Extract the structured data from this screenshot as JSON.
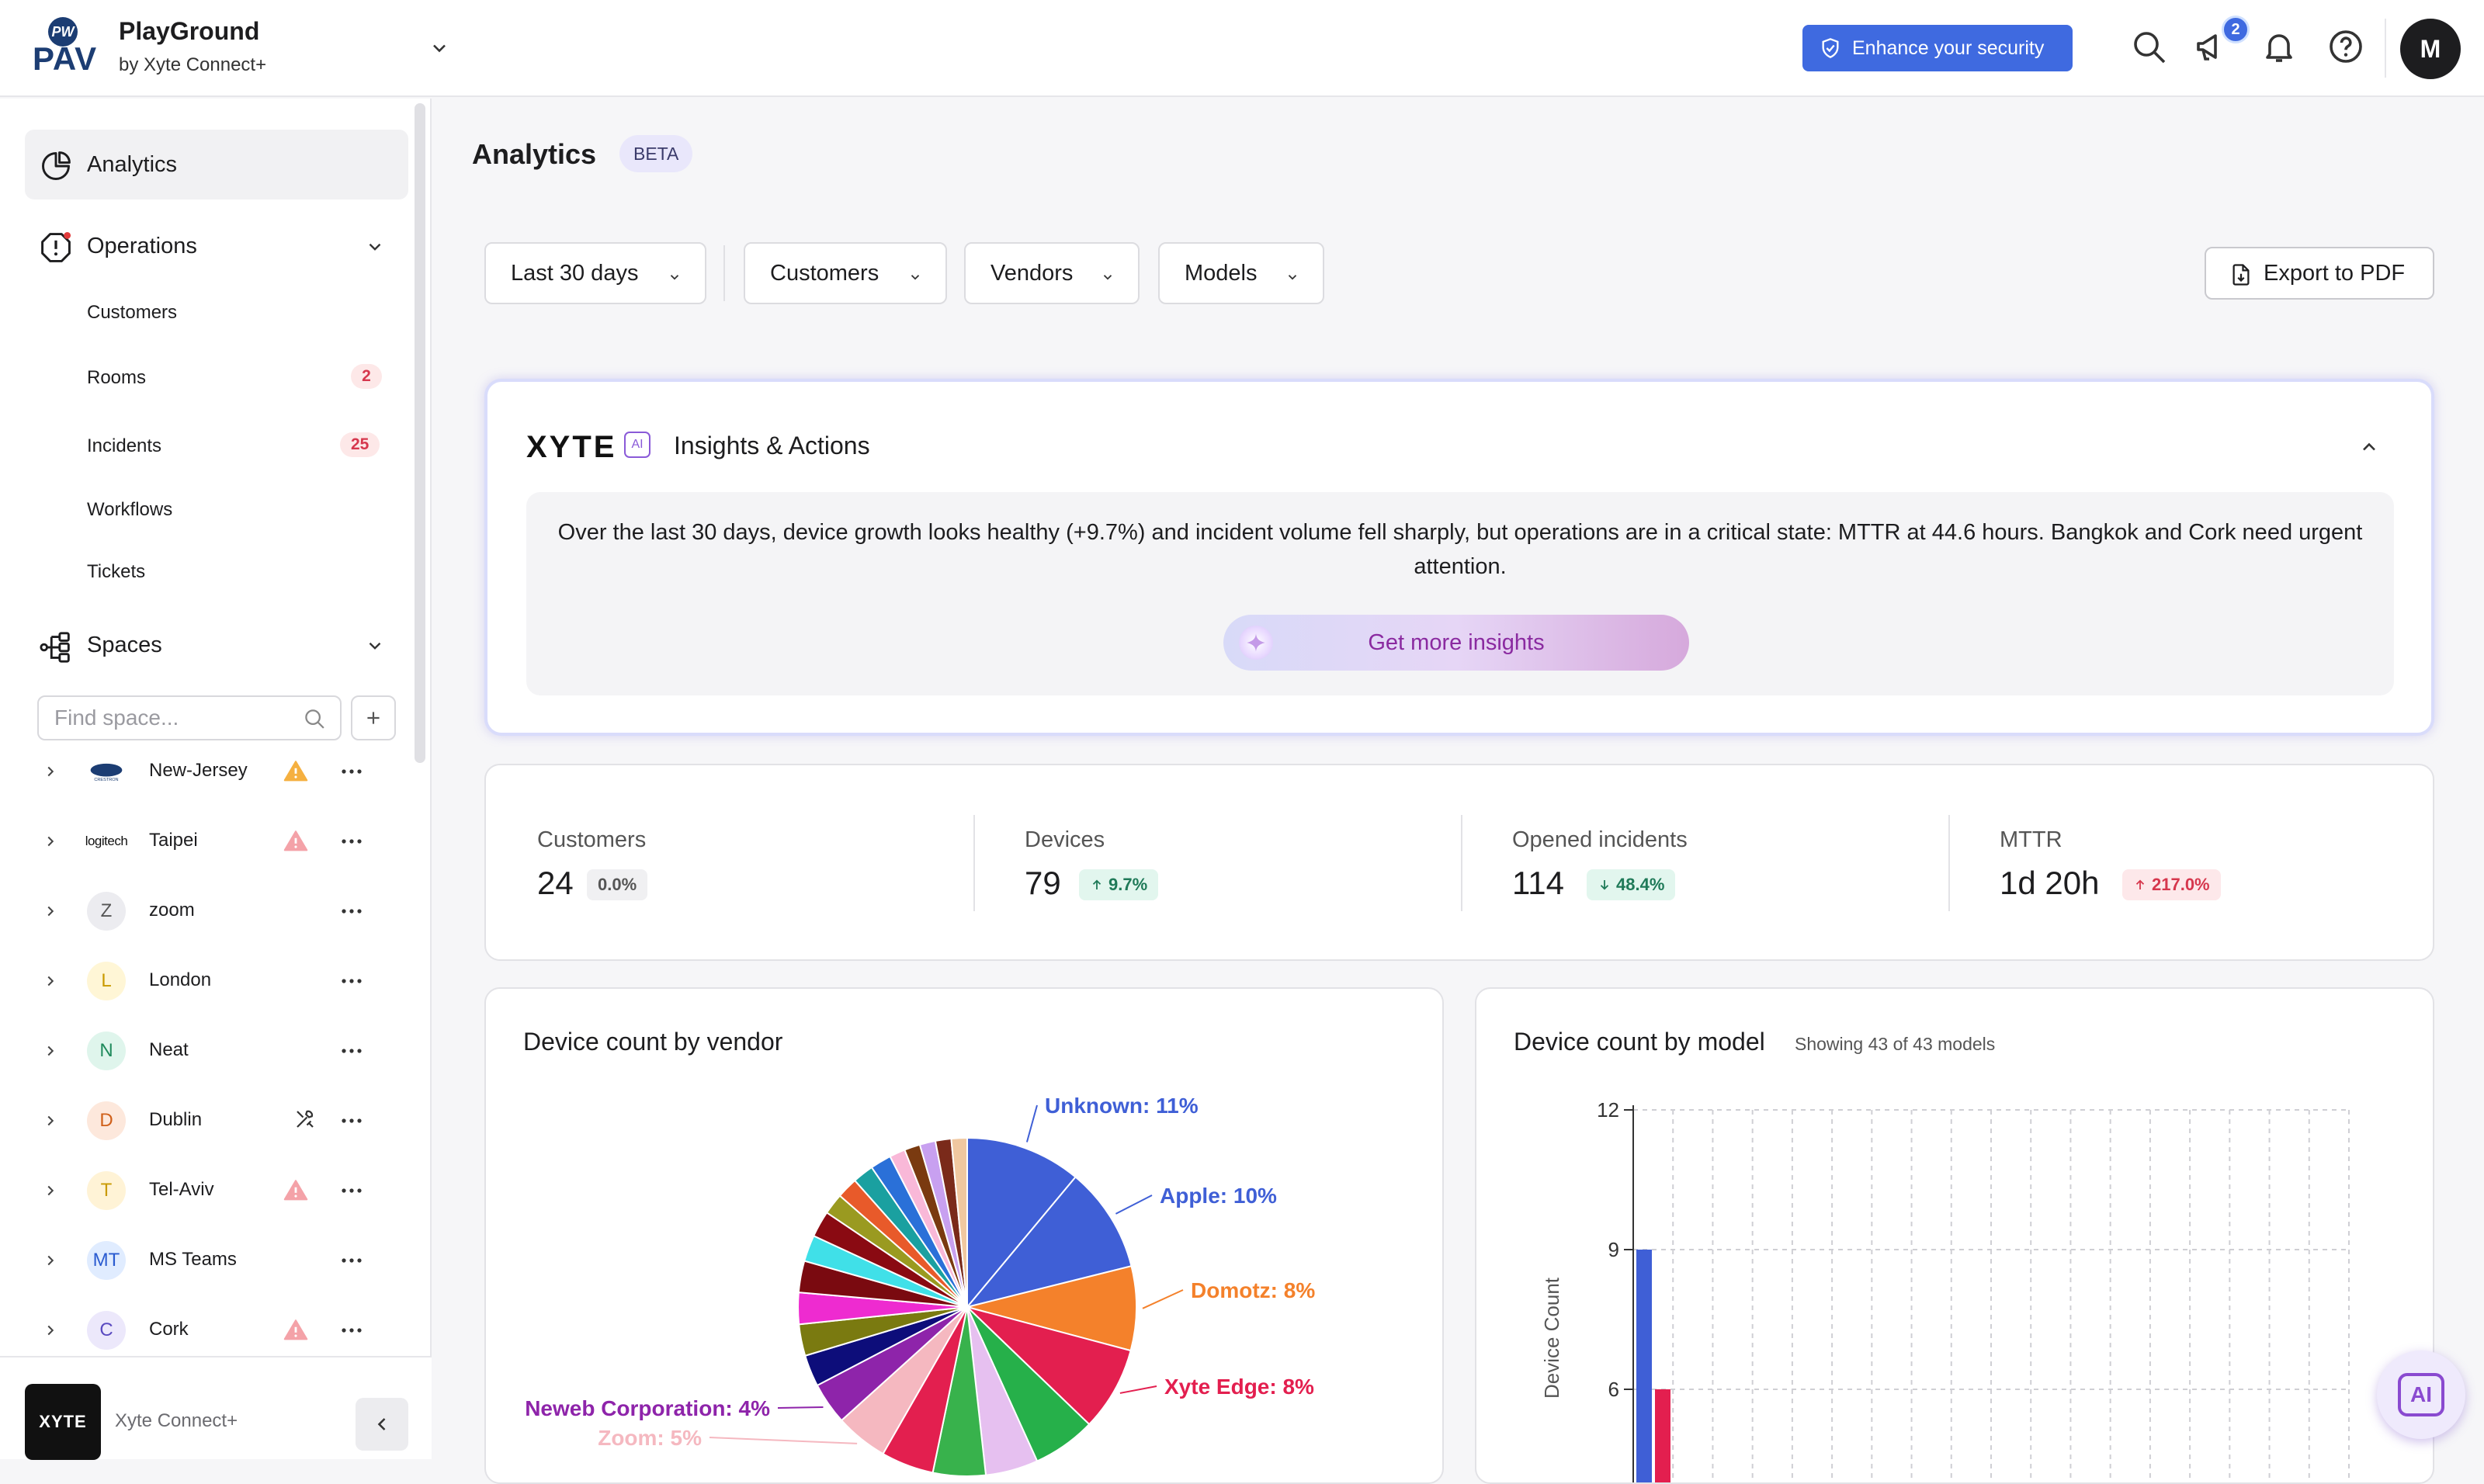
{
  "org": {
    "name": "PlayGround",
    "sub": "by Xyte Connect+",
    "logo_text": "PAV",
    "logo_mark": "PW"
  },
  "topbar": {
    "security_label": "Enhance your security",
    "notifications_count": "2",
    "avatar_initial": "M"
  },
  "sidebar": {
    "analytics_label": "Analytics",
    "operations_label": "Operations",
    "operations_items": [
      {
        "label": "Customers",
        "count": ""
      },
      {
        "label": "Rooms",
        "count": "2"
      },
      {
        "label": "Incidents",
        "count": "25"
      },
      {
        "label": "Workflows",
        "count": ""
      },
      {
        "label": "Tickets",
        "count": ""
      }
    ],
    "spaces_label": "Spaces",
    "find_placeholder": "Find space...",
    "spaces": [
      {
        "name": "New-Jersey",
        "avatar": "CRESTRON",
        "status": "warning-orange"
      },
      {
        "name": "Taipei",
        "avatar": "logitech",
        "status": "warning-red"
      },
      {
        "name": "zoom",
        "avatar": "Z",
        "status": ""
      },
      {
        "name": "London",
        "avatar": "L",
        "status": ""
      },
      {
        "name": "Neat",
        "avatar": "N",
        "status": ""
      },
      {
        "name": "Dublin",
        "avatar": "D",
        "status": "tools"
      },
      {
        "name": "Tel-Aviv",
        "avatar": "T",
        "status": "warning-red"
      },
      {
        "name": "MS Teams",
        "avatar": "MT",
        "status": ""
      },
      {
        "name": "Cork",
        "avatar": "C",
        "status": "warning-red"
      }
    ],
    "footer": {
      "logo": "XYTE",
      "name": "Xyte Connect+"
    }
  },
  "page": {
    "title": "Analytics",
    "badge": "BETA"
  },
  "filters": {
    "range": "Last 30 days",
    "customers": "Customers",
    "vendors": "Vendors",
    "models": "Models",
    "export": "Export to PDF"
  },
  "insights": {
    "logo": "XYTE",
    "logo_ai": "AI",
    "title": "Insights & Actions",
    "text": "Over the last 30 days, device growth looks healthy (+9.7%) and incident volume fell sharply, but operations are in a critical state: MTTR at 44.6 hours. Bangkok and Cork need urgent attention.",
    "button": "Get more insights"
  },
  "stats": [
    {
      "label": "Customers",
      "value": "24",
      "delta": "0.0%",
      "trend": "neutral"
    },
    {
      "label": "Devices",
      "value": "79",
      "delta": "9.7%",
      "trend": "up-good"
    },
    {
      "label": "Opened incidents",
      "value": "114",
      "delta": "48.4%",
      "trend": "down-good"
    },
    {
      "label": "MTTR",
      "value": "1d 20h",
      "delta": "217.0%",
      "trend": "up-bad"
    }
  ],
  "vendor_card": {
    "title": "Device count by vendor"
  },
  "model_card": {
    "title": "Device count by model",
    "subtitle": "Showing 43 of 43 models"
  },
  "ai_fab": "AI",
  "chart_data": [
    {
      "type": "pie",
      "title": "Device count by vendor",
      "slices": [
        {
          "label": "Unknown: 11%",
          "value": 11,
          "color": "#3f5fd6",
          "show": true
        },
        {
          "label": "Apple: 10%",
          "value": 10,
          "color": "#3f5fd6",
          "show": true
        },
        {
          "label": "Domotz: 8%",
          "value": 8,
          "color": "#f4812b",
          "show": true
        },
        {
          "label": "Xyte Edge: 8%",
          "value": 8,
          "color": "#e31f4f",
          "show": true
        },
        {
          "label": "",
          "value": 6,
          "color": "#26b04a",
          "show": false
        },
        {
          "label": "",
          "value": 5,
          "color": "#e6c0f0",
          "show": false
        },
        {
          "label": "",
          "value": 5,
          "color": "#38b24c",
          "show": false
        },
        {
          "label": "",
          "value": 5,
          "color": "#e31f4f",
          "show": false
        },
        {
          "label": "Zoom: 5%",
          "value": 5,
          "color": "#f5b8c0",
          "show": true
        },
        {
          "label": "Neweb Corporation: 4%",
          "value": 4,
          "color": "#8e24aa",
          "show": true
        },
        {
          "label": "",
          "value": 3,
          "color": "#0d0d7a",
          "show": false
        },
        {
          "label": "",
          "value": 3,
          "color": "#7a7a10",
          "show": false
        },
        {
          "label": "",
          "value": 3,
          "color": "#ee2bd0",
          "show": false
        },
        {
          "label": "",
          "value": 3,
          "color": "#7a0a10",
          "show": false
        },
        {
          "label": "",
          "value": 2.5,
          "color": "#40e0e8",
          "show": false
        },
        {
          "label": "",
          "value": 2.5,
          "color": "#8a0a12",
          "show": false
        },
        {
          "label": "",
          "value": 2,
          "color": "#9a9a20",
          "show": false
        },
        {
          "label": "",
          "value": 2,
          "color": "#e85a2a",
          "show": false
        },
        {
          "label": "",
          "value": 2,
          "color": "#1aa0a0",
          "show": false
        },
        {
          "label": "",
          "value": 2,
          "color": "#2a70d8",
          "show": false
        },
        {
          "label": "",
          "value": 1.5,
          "color": "#f9b8d8",
          "show": false
        },
        {
          "label": "",
          "value": 1.5,
          "color": "#7a3a10",
          "show": false
        },
        {
          "label": "",
          "value": 1.5,
          "color": "#c8a0f0",
          "show": false
        },
        {
          "label": "",
          "value": 1.5,
          "color": "#7a2a1a",
          "show": false
        },
        {
          "label": "",
          "value": 1.5,
          "color": "#f0c8a0",
          "show": false
        }
      ]
    },
    {
      "type": "bar",
      "title": "Device count by model",
      "ylabel": "Device Count",
      "yticks": [
        12,
        9,
        6
      ],
      "ylim": [
        0,
        12
      ],
      "series": [
        {
          "values": [
            9
          ],
          "color": "#3f5fd6"
        },
        {
          "values": [
            6
          ],
          "color": "#e31f4f"
        }
      ]
    }
  ]
}
